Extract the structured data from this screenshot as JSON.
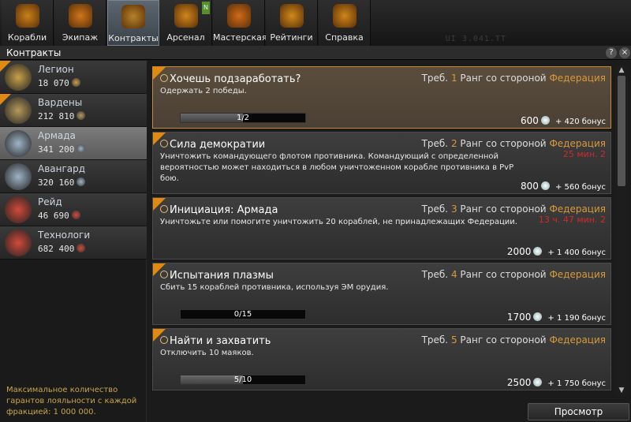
{
  "nav": {
    "items": [
      {
        "label": "Корабли",
        "icon": "ships-icon"
      },
      {
        "label": "Экипаж",
        "icon": "crew-icon"
      },
      {
        "label": "Контракты",
        "icon": "contracts-icon"
      },
      {
        "label": "Арсенал",
        "icon": "arsenal-icon"
      },
      {
        "label": "Мастерская",
        "icon": "workshop-icon"
      },
      {
        "label": "Рейтинги",
        "icon": "ratings-icon"
      },
      {
        "label": "Справка",
        "icon": "help-icon"
      }
    ],
    "active_index": 2,
    "version": "UI 3.041.TT"
  },
  "window": {
    "title": "Контракты",
    "help": "?",
    "close": "×"
  },
  "factions": [
    {
      "name": "Легион",
      "value": "18 070",
      "color": "#c9a24a"
    },
    {
      "name": "Вардены",
      "value": "212 810",
      "color": "#b89a5a"
    },
    {
      "name": "Армада",
      "value": "341 200",
      "color": "#9fb4c8"
    },
    {
      "name": "Авангард",
      "value": "320 160",
      "color": "#9fb4c8"
    },
    {
      "name": "Рейд",
      "value": "46 690",
      "color": "#d24a3a"
    },
    {
      "name": "Технологи",
      "value": "682 400",
      "color": "#d24a3a"
    }
  ],
  "info_text": "Максимальное количество гарантов лояльности с каждой фракцией: 1 000 000.",
  "contracts": [
    {
      "title": "Хочешь подзаработать?",
      "desc": "Одержать 2 победы.",
      "req_prefix": "Треб.",
      "rank": "1",
      "req_mid": "Ранг со стороной",
      "faction": "Федерация",
      "timer": "",
      "progress": "1/2",
      "progress_value": 0.5,
      "reward": "600",
      "bonus": "+ 420 бонус"
    },
    {
      "title": "Сила демократии",
      "desc": "Уничтожить командующего флотом противника. Командующий с определенной вероятностью может находиться в любом уничтоженном корабле противника в PvP бою.",
      "req_prefix": "Треб.",
      "rank": "2",
      "req_mid": "Ранг со стороной",
      "faction": "Федерация",
      "timer": "25 мин. 2",
      "progress": "",
      "progress_value": null,
      "reward": "800",
      "bonus": "+ 560 бонус"
    },
    {
      "title": "Инициация: Армада",
      "desc": "Уничтожьте или помогите уничтожить 20 кораблей, не принадлежащих Федерации.",
      "req_prefix": "Треб.",
      "rank": "3",
      "req_mid": "Ранг со стороной",
      "faction": "Федерация",
      "timer": "13 ч. 47 мин. 2",
      "progress": "",
      "progress_value": null,
      "reward": "2000",
      "bonus": "+ 1 400 бонус"
    },
    {
      "title": "Испытания плазмы",
      "desc": "Сбить 15 кораблей противника, используя ЭМ орудия.",
      "req_prefix": "Треб.",
      "rank": "4",
      "req_mid": "Ранг со стороной",
      "faction": "Федерация",
      "timer": "",
      "progress": "0/15",
      "progress_value": 0,
      "reward": "1700",
      "bonus": "+ 1 190 бонус"
    },
    {
      "title": "Найти и захватить",
      "desc": "Отключить 10 маяков.",
      "req_prefix": "Треб.",
      "rank": "5",
      "req_mid": "Ранг со стороной",
      "faction": "Федерация",
      "timer": "",
      "progress": "5/10",
      "progress_value": 0.5,
      "reward": "2500",
      "bonus": "+ 1 750 бонус"
    }
  ],
  "view_button": "Просмотр",
  "colors": {
    "accent": "#e08a12",
    "selected_border": "#c98a2b",
    "timer": "#d02a2a"
  }
}
